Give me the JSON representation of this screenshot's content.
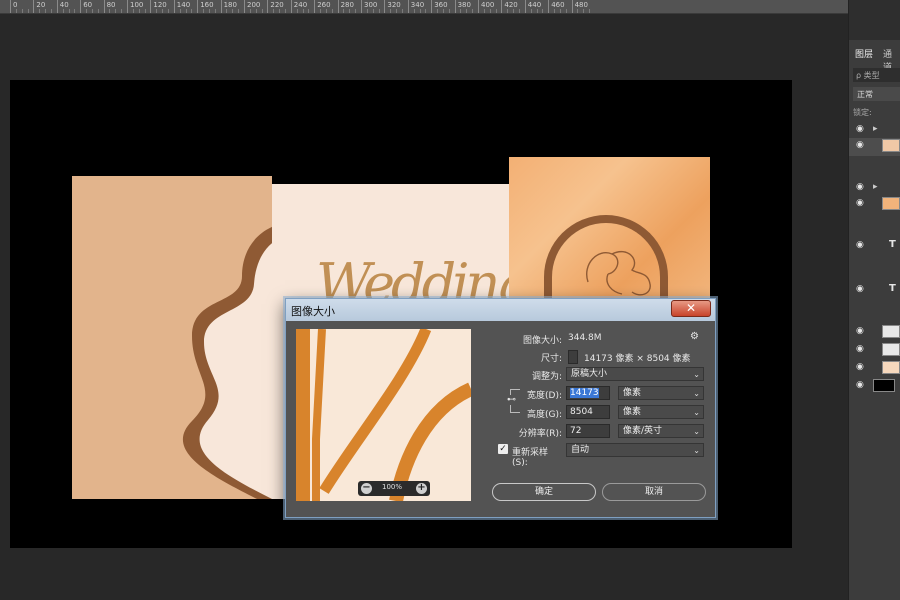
{
  "ruler": {
    "labels": [
      "0",
      "20",
      "40",
      "60",
      "80",
      "100",
      "120",
      "140",
      "160",
      "180",
      "200",
      "220",
      "240",
      "260",
      "280",
      "300",
      "320",
      "340",
      "360",
      "380",
      "400",
      "420",
      "440",
      "460",
      "480"
    ]
  },
  "colors": {
    "workspace": "#282828",
    "canvas_bg": "#000000",
    "tan": "#e2b48c",
    "brown": "#8f5a34",
    "cream": "#f8e7da",
    "orange_stroke": "#d8842c",
    "dialog_bg": "#535353",
    "highlight": "#3b78d6"
  },
  "artboard": {
    "script_text": "Wedding"
  },
  "dialog": {
    "title": "图像大小",
    "close_symbol": "✕",
    "image_size_label": "图像大小:",
    "image_size_value": "344.8M",
    "settings_icon": "gear-icon",
    "dimensions_label": "尺寸:",
    "dimensions_value": "14173 像素 × 8504 像素",
    "fit_to_label": "调整为:",
    "fit_to_value": "原稿大小",
    "width_label": "宽度(D):",
    "width_value": "14173",
    "width_unit": "像素",
    "height_label": "高度(G):",
    "height_value": "8504",
    "height_unit": "像素",
    "resolution_label": "分辨率(R):",
    "resolution_value": "72",
    "resolution_unit": "像素/英寸",
    "resample_label": "重新采样(S):",
    "resample_checked": true,
    "resample_value": "自动",
    "ok_label": "确定",
    "cancel_label": "取消",
    "zoom_value": "100%",
    "zoom_out_symbol": "−",
    "zoom_in_symbol": "+"
  },
  "layers_panel": {
    "tab_layers": "图层",
    "tab_channels": "通道",
    "search_placeholder": "ρ 类型",
    "blend_mode": "正常",
    "lock_label": "锁定:",
    "type_layer_symbol": "T",
    "clip_symbol": "↲",
    "eye_symbol": "👁"
  }
}
